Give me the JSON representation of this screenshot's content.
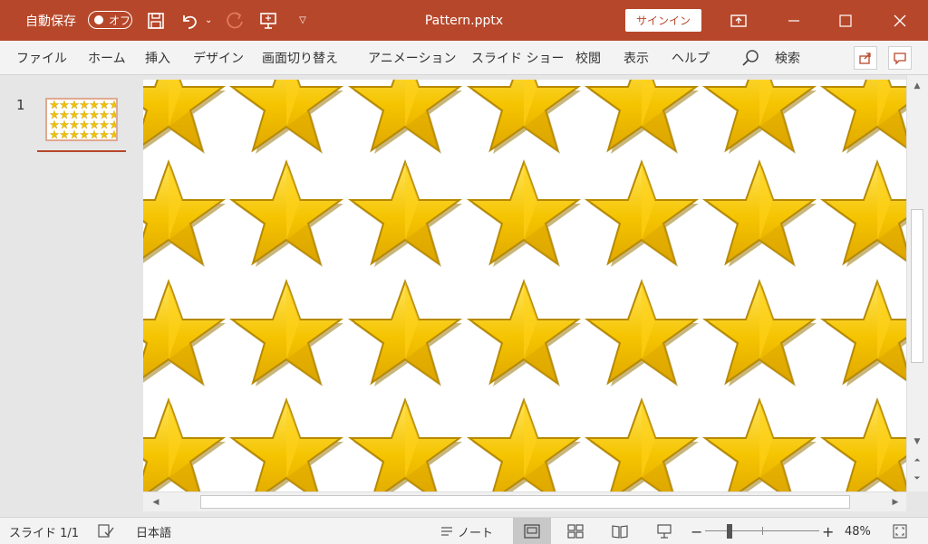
{
  "titlebar": {
    "autosave_label": "自動保存",
    "autosave_state": "オフ",
    "document_title": "Pattern.pptx",
    "signin_label": "サインイン",
    "bg_color": "#b7472a"
  },
  "menu": {
    "items": [
      "ファイル",
      "ホーム",
      "挿入",
      "デザイン",
      "画面切り替え",
      "アニメーション",
      "スライド ショー",
      "校閲",
      "表示",
      "ヘルプ"
    ],
    "search_label": "検索"
  },
  "thumbnails": {
    "slide_number": "1"
  },
  "slide": {
    "pattern": "gold-five-point-stars",
    "star_color": "#f5c400"
  },
  "statusbar": {
    "slide_info": "スライド 1/1",
    "language": "日本語",
    "notes_label": "ノート",
    "zoom_percent": "48%",
    "zoom_value": 48
  }
}
